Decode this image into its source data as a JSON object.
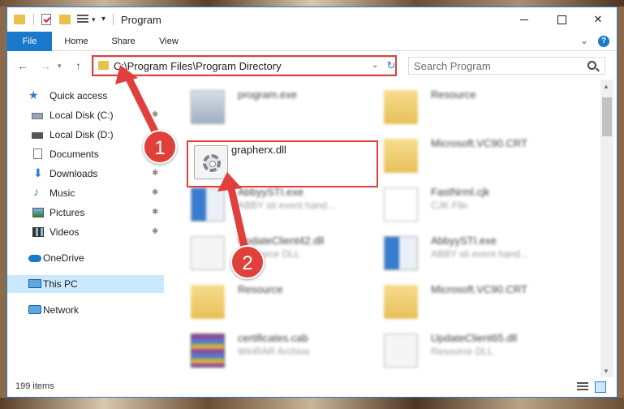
{
  "window": {
    "title": "Program"
  },
  "ribbon": {
    "tabs": [
      "File",
      "Home",
      "Share",
      "View"
    ],
    "help": "?"
  },
  "nav": {
    "address": "C:\\Program Files\\Program Directory",
    "search_placeholder": "Search Program"
  },
  "sidebar": {
    "items": [
      {
        "label": "Quick access",
        "icon": "star-icon"
      },
      {
        "label": "Local Disk (C:)",
        "icon": "disk-icon",
        "pinned": true
      },
      {
        "label": "Local Disk (D:)",
        "icon": "disk-icon",
        "pinned": true
      },
      {
        "label": "Documents",
        "icon": "documents-icon",
        "pinned": true
      },
      {
        "label": "Downloads",
        "icon": "downloads-icon",
        "pinned": true
      },
      {
        "label": "Music",
        "icon": "music-icon",
        "pinned": true
      },
      {
        "label": "Pictures",
        "icon": "pictures-icon",
        "pinned": true
      },
      {
        "label": "Videos",
        "icon": "videos-icon",
        "pinned": true
      },
      {
        "label": "OneDrive",
        "icon": "onedrive-icon"
      },
      {
        "label": "This PC",
        "icon": "pc-icon",
        "selected": true
      },
      {
        "label": "Network",
        "icon": "network-icon"
      }
    ]
  },
  "files": [
    {
      "name": "program.exe",
      "sub": "",
      "type": "exe"
    },
    {
      "name": "Resource",
      "sub": "",
      "type": "folder"
    },
    {
      "name": "grapherx.dll",
      "sub": "",
      "type": "dll"
    },
    {
      "name": "Microsoft.VC90.CRT",
      "sub": "",
      "type": "folder"
    },
    {
      "name": "AbbyySTI.exe",
      "sub": "ABBY sti event hand...",
      "type": "app"
    },
    {
      "name": "FastNrml.cjk",
      "sub": "CJK File",
      "type": "file"
    },
    {
      "name": "UpdateClient42.dll",
      "sub": "Resource DLL",
      "type": "dll"
    },
    {
      "name": "AbbyySTI.exe",
      "sub": "ABBY sti event hand...",
      "type": "app"
    },
    {
      "name": "Resource",
      "sub": "",
      "type": "folder"
    },
    {
      "name": "Microsoft.VC90.CRT",
      "sub": "",
      "type": "folder"
    },
    {
      "name": "certificates.cab",
      "sub": "WinRAR Archive",
      "type": "cab"
    },
    {
      "name": "UpdateClient65.dll",
      "sub": "Resource DLL",
      "type": "dll"
    }
  ],
  "status": {
    "count": "199 items"
  },
  "annotations": {
    "badge1": "1",
    "badge2": "2",
    "color": "#e0403c"
  },
  "colors": {
    "accent": "#1979ca",
    "highlight": "#e0403c",
    "selected": "#cce8ff"
  }
}
